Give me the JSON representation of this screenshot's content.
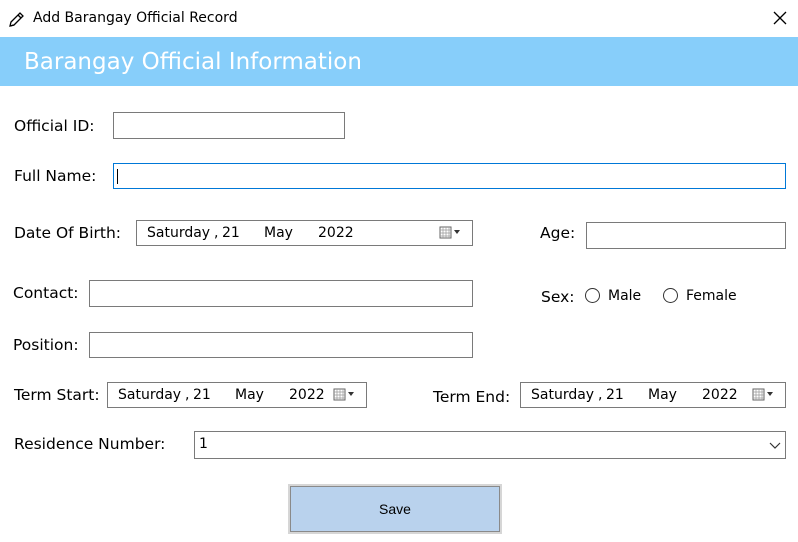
{
  "window": {
    "title": "Add Barangay Official Record",
    "icon": "pencil-icon",
    "close_icon": "close-icon"
  },
  "banner": {
    "title": "Barangay Official Information",
    "color": "#87cefa"
  },
  "form": {
    "official_id": {
      "label": "Official ID:",
      "value": ""
    },
    "full_name": {
      "label": "Full Name:",
      "value": ""
    },
    "date_of_birth": {
      "label": "Date Of Birth:",
      "weekday": "Saturday",
      "sep": ",",
      "day": "21",
      "month": "May",
      "year": "2022"
    },
    "age": {
      "label": "Age:",
      "value": ""
    },
    "contact": {
      "label": "Contact:",
      "value": ""
    },
    "sex": {
      "label": "Sex:",
      "options": [
        "Male",
        "Female"
      ],
      "selected": null
    },
    "position": {
      "label": "Position:",
      "value": ""
    },
    "term_start": {
      "label": "Term Start:",
      "weekday": "Saturday",
      "sep": ",",
      "day": "21",
      "month": "May",
      "year": "2022"
    },
    "term_end": {
      "label": "Term End:",
      "weekday": "Saturday",
      "sep": ",",
      "day": "21",
      "month": "May",
      "year": "2022"
    },
    "residence_number": {
      "label": "Residence Number:",
      "value": "1"
    }
  },
  "actions": {
    "save_label": "Save",
    "save_color": "#b9d2ed"
  }
}
